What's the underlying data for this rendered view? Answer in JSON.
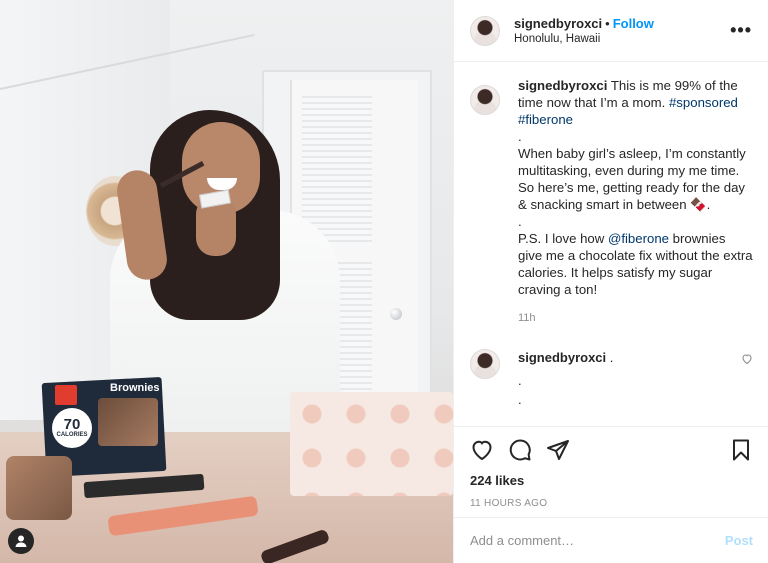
{
  "post": {
    "image_alt": "Woman in white robe applying makeup holding Fiber One brownies box",
    "box": {
      "brand_text": "Brownies",
      "calories_number": "70",
      "calories_label": "CALORIES"
    }
  },
  "header": {
    "username": "signedbyroxci",
    "separator": "•",
    "follow_label": "Follow",
    "location": "Honolulu, Hawaii",
    "more_icon": "more-horizontal-icon",
    "more_label": "•••"
  },
  "caption": {
    "username": "signedbyroxci",
    "text_1": " This is me 99% of the time now that I’m a mom. ",
    "hashtag_1": "#sponsored",
    "hashtag_2": "#fiberone",
    "dot_1": ".",
    "paragraph_2": "When baby girl’s asleep, I’m constantly multitasking, even during my me time. So here’s me, getting ready for the day & snacking smart in between 🍫.",
    "dot_2": ".",
    "ps_start": "P.S. I love how ",
    "mention": "@fiberone",
    "ps_end": " brownies give me a chocolate fix without the extra calories. It helps satisfy my sugar craving a ton!",
    "time": "11h"
  },
  "comment": {
    "username": "signedbyroxci",
    "text": " .",
    "line_2": ".",
    "line_3": "."
  },
  "actions": {
    "likes": "224 likes",
    "time_ago": "11 HOURS AGO"
  },
  "add_comment": {
    "placeholder": "Add a comment…",
    "post_label": "Post"
  },
  "colors": {
    "link_blue": "#0095f6",
    "hashtag": "#00376b",
    "muted": "#8e8e8e",
    "post_disabled": "#b2dffc"
  }
}
